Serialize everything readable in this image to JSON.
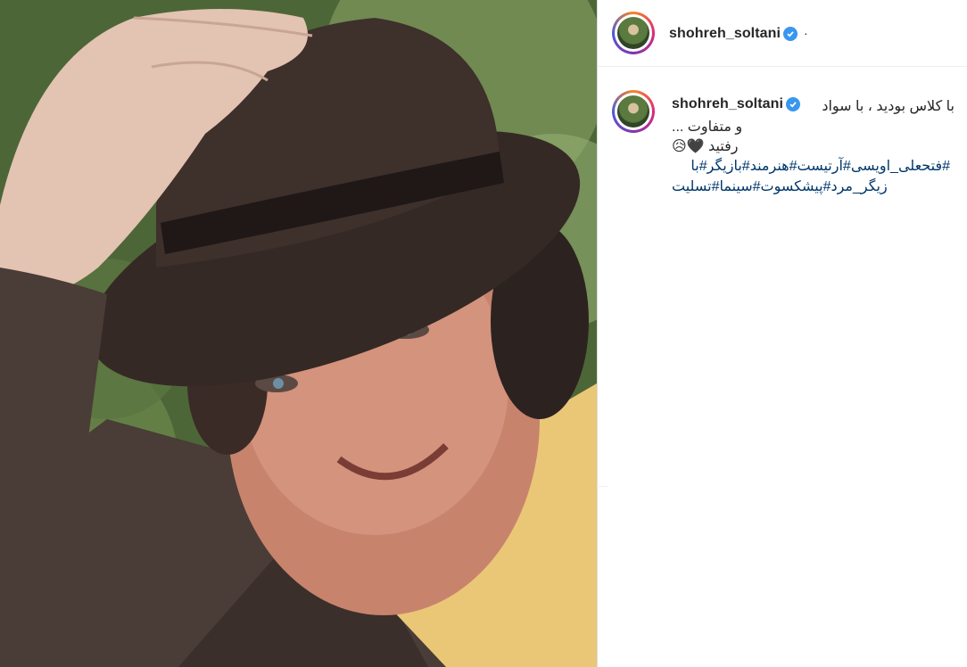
{
  "post": {
    "username": "shohreh_soltani",
    "header_dot": "·",
    "caption_line1": "با کلاس بودید ، با سواد",
    "caption_line2": "و متفاوت ...",
    "caption_line3": "رفتید 🖤😥",
    "hashtags_line1": "#فتحعلی_اویسی#آرتیست#هنرمند#بازیگر#با",
    "hashtags_line2": "زیگر_مرد#پیشکسوت#سینما#تسلیت"
  },
  "colors": {
    "verified": "#3897f0",
    "hashtag": "#00376b"
  },
  "icons": [
    "verified-badge-icon",
    "avatar-ring"
  ]
}
